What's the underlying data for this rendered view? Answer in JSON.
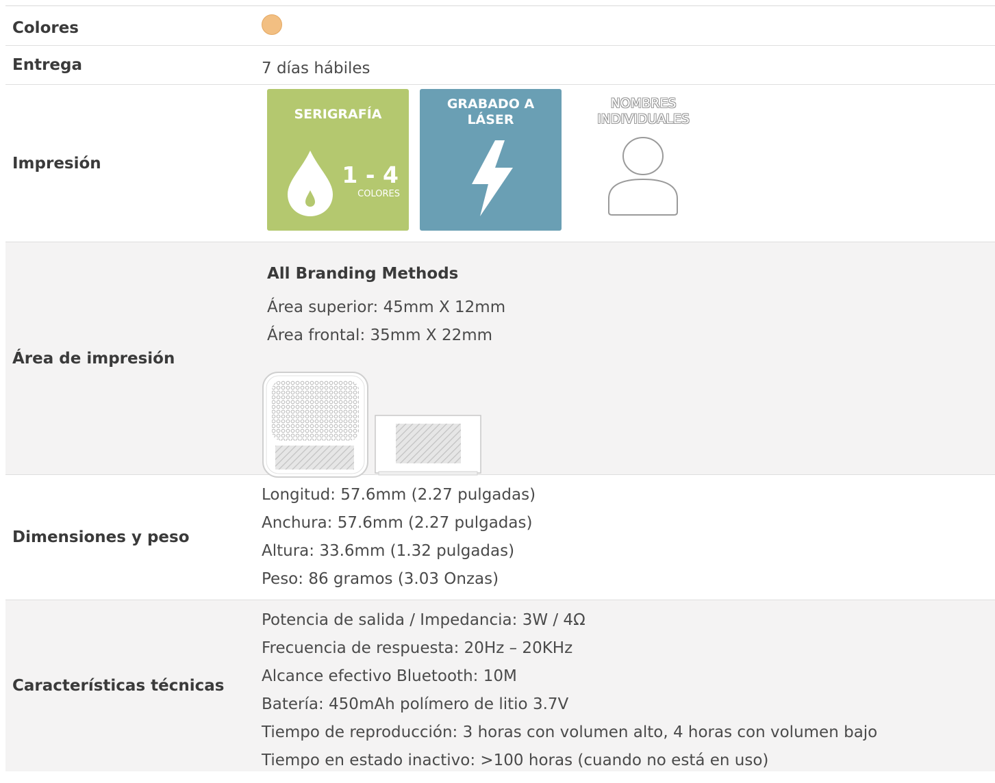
{
  "rows": {
    "colores": {
      "label": "Colores",
      "swatch_color": "#f2bf82"
    },
    "entrega": {
      "label": "Entrega",
      "value": "7 días hábiles"
    },
    "impresion": {
      "label": "Impresión",
      "badges": [
        {
          "title": "SERIGRAFÍA",
          "big": "1 - 4",
          "small": "COLORES",
          "icon": "ink-drop-icon",
          "color": "#b4c86f"
        },
        {
          "title_line1": "GRABADO A",
          "title_line2": "LÁSER",
          "icon": "lightning-bolt-icon",
          "color": "#6a9fb4"
        },
        {
          "title_line1": "NOMBRES",
          "title_line2": "INDIVIDUALES",
          "icon": "person-icon"
        }
      ]
    },
    "area": {
      "label": "Área de impresión",
      "heading": "All Branding Methods",
      "line1": "Área superior: 45mm X 12mm",
      "line2": "Área frontal: 35mm X 22mm"
    },
    "dimensiones": {
      "label": "Dimensiones y peso",
      "lines": [
        "Longitud: 57.6mm (2.27 pulgadas)",
        "Anchura: 57.6mm (2.27 pulgadas)",
        "Altura: 33.6mm (1.32 pulgadas)",
        "Peso: 86 gramos (3.03 Onzas)"
      ]
    },
    "tecnicas": {
      "label": "Características técnicas",
      "lines": [
        "Potencia de salida / Impedancia: 3W / 4Ω",
        "Frecuencia de respuesta: 20Hz – 20KHz",
        "Alcance efectivo Bluetooth: 10M",
        "Batería: 450mAh polímero de litio 3.7V",
        "Tiempo de reproducción: 3 horas con volumen alto, 4 horas con volumen bajo",
        "Tiempo en estado inactivo: >100 horas (cuando no está en uso)"
      ]
    }
  }
}
